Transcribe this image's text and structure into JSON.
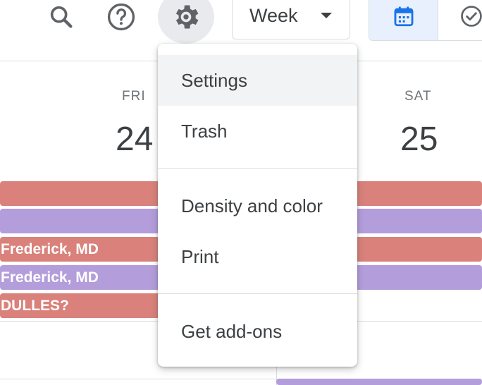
{
  "toolbar": {
    "search_icon": "search-icon",
    "help_icon": "help-icon",
    "settings_icon": "gear-icon",
    "view_select": {
      "label": "Week"
    },
    "view_switch": [
      "calendar-icon",
      "check-circle-icon"
    ]
  },
  "days": [
    {
      "dow": "FRI",
      "num": "24"
    },
    {
      "dow": "SAT",
      "num": "25"
    }
  ],
  "events": [
    {
      "label": "",
      "color": "#d9817a"
    },
    {
      "label": "",
      "color": "#b39ddb"
    },
    {
      "label": "Frederick, MD",
      "color": "#d9817a"
    },
    {
      "label": "Frederick, MD",
      "color": "#b39ddb"
    },
    {
      "label": "DULLES?",
      "color": "#d9817a"
    }
  ],
  "menu": {
    "items": [
      {
        "label": "Settings"
      },
      {
        "label": "Trash"
      },
      {
        "label": "Density and color"
      },
      {
        "label": "Print"
      },
      {
        "label": "Get add-ons"
      }
    ]
  },
  "colors": {
    "accent": "#1a73e8",
    "selected_bg": "#e8f0fe",
    "event_red": "#d9817a",
    "event_purple": "#b39ddb"
  }
}
